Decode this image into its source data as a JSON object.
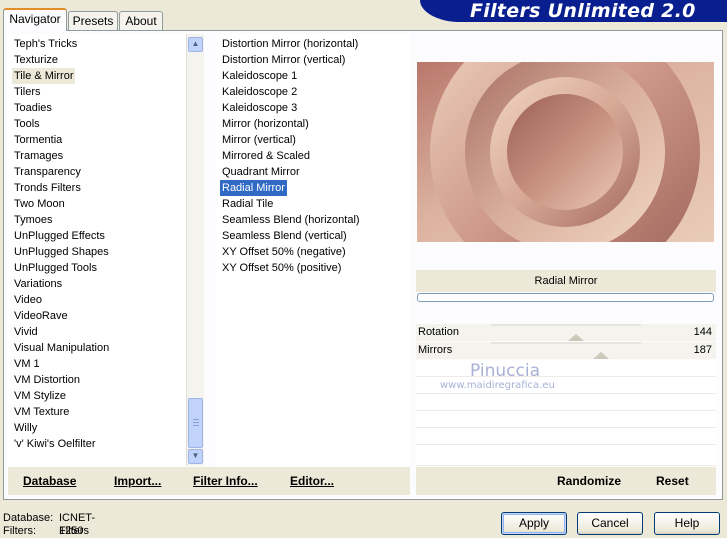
{
  "banner": {
    "title": "Filters Unlimited 2.0"
  },
  "tabs": [
    {
      "label": "Navigator",
      "active": true
    },
    {
      "label": "Presets",
      "active": false
    },
    {
      "label": "About",
      "active": false
    }
  ],
  "categories": {
    "items": [
      "Teph's Tricks",
      "Texturize",
      "Tile & Mirror",
      "Tilers",
      "Toadies",
      "Tools",
      "Tormentia",
      "Tramages",
      "Transparency",
      "Tronds Filters",
      "Two Moon",
      "Tymoes",
      "UnPlugged Effects",
      "UnPlugged Shapes",
      "UnPlugged Tools",
      "Variations",
      "Video",
      "VideoRave",
      "Vivid",
      "Visual Manipulation",
      "VM 1",
      "VM Distortion",
      "VM Stylize",
      "VM Texture",
      "Willy",
      "'v' Kiwi's Oelfilter"
    ],
    "selected": "Tile & Mirror"
  },
  "filters": {
    "items": [
      "Distortion Mirror (horizontal)",
      "Distortion Mirror (vertical)",
      "Kaleidoscope 1",
      "Kaleidoscope 2",
      "Kaleidoscope 3",
      "Mirror (horizontal)",
      "Mirror (vertical)",
      "Mirrored & Scaled",
      "Quadrant Mirror",
      "Radial Mirror",
      "Radial Tile",
      "Seamless Blend (horizontal)",
      "Seamless Blend (vertical)",
      "XY Offset 50% (negative)",
      "XY Offset 50% (positive)"
    ],
    "selected": "Radial Mirror"
  },
  "left_buttons": {
    "database": "Database",
    "import": "Import...",
    "filter_info": "Filter Info...",
    "editor": "Editor..."
  },
  "right_buttons": {
    "randomize": "Randomize",
    "reset": "Reset"
  },
  "effect": {
    "name": "Radial Mirror",
    "progress": 0
  },
  "params": [
    {
      "label": "Rotation",
      "value": "144",
      "level": 0.565
    },
    {
      "label": "Mirrors",
      "value": "187",
      "level": 0.733
    }
  ],
  "watermark": {
    "line1": "Pinuccia",
    "line2": "www.maidiregrafica.eu"
  },
  "status": {
    "database_label": "Database:",
    "database_value": "ICNET-Filters",
    "filters_label": "Filters:",
    "filters_value": "1250"
  },
  "dialog_buttons": {
    "apply": "Apply",
    "cancel": "Cancel",
    "help": "Help"
  },
  "colors": {
    "selection": "#316ac5",
    "banner": "#0a1f8f",
    "preview_light": "#e8c2b0",
    "preview_dark": "#9c6258"
  }
}
